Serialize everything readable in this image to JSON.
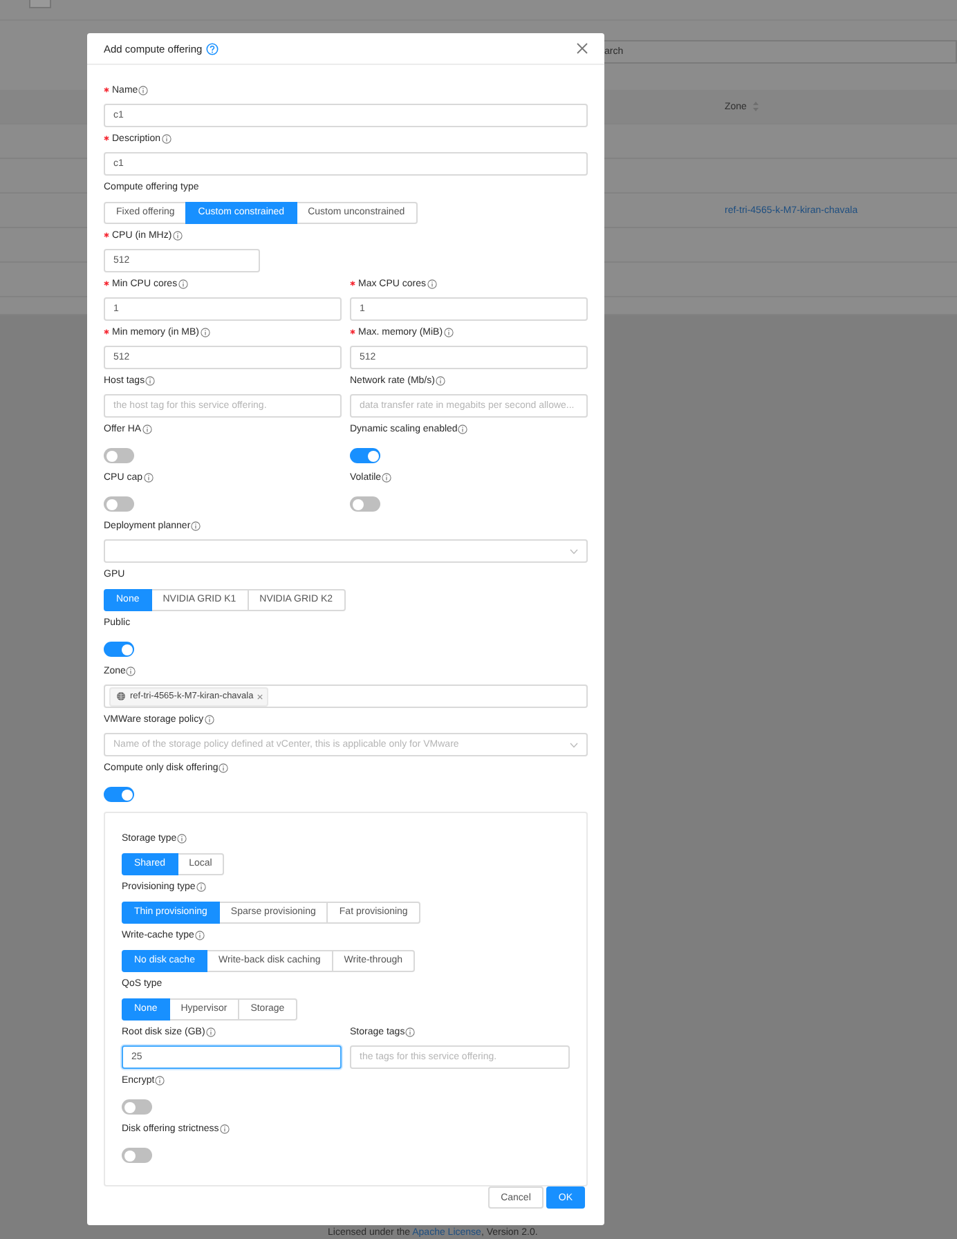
{
  "page": {
    "search": {
      "placeholder": "arch"
    },
    "table": {
      "columns": [
        "Zone"
      ],
      "rows": [
        {
          "zone": "ref-tri-4565-k-M7-kiran-chavala"
        }
      ]
    },
    "footer": {
      "before": "Licensed under the ",
      "link": "Apache License",
      "after": ", Version 2.0."
    }
  },
  "dialog": {
    "title": "Add compute offering",
    "rows": [
      {
        "fields": [
          {
            "label": "Name",
            "required": true,
            "info": true,
            "kind": "input",
            "value": "c1"
          }
        ]
      },
      {
        "fields": [
          {
            "label": "Description",
            "required": true,
            "info": true,
            "kind": "input",
            "value": "c1"
          }
        ]
      },
      {
        "fields": [
          {
            "label": "Compute offering type",
            "required": false,
            "info": false,
            "kind": "segmented",
            "options": [
              {
                "label": "Fixed offering",
                "selected": false
              },
              {
                "label": "Custom constrained",
                "selected": true
              },
              {
                "label": "Custom unconstrained",
                "selected": false
              }
            ]
          }
        ]
      },
      {
        "fields": [
          {
            "label": "CPU (in MHz)",
            "required": true,
            "info": true,
            "kind": "number",
            "value": "512"
          }
        ]
      },
      {
        "fields": [
          {
            "label": "Min CPU cores",
            "required": true,
            "info": true,
            "kind": "number",
            "value": "1"
          },
          {
            "label": "Max CPU cores",
            "required": true,
            "info": true,
            "kind": "number",
            "value": "1"
          }
        ]
      },
      {
        "fields": [
          {
            "label": "Min memory (in MB)",
            "required": true,
            "info": true,
            "kind": "number",
            "value": "512"
          },
          {
            "label": "Max. memory (MiB)",
            "required": true,
            "info": true,
            "kind": "number",
            "value": "512"
          }
        ]
      },
      {
        "fields": [
          {
            "label": "Host tags",
            "required": false,
            "info": true,
            "kind": "input",
            "placeholder": "the host tag for this service offering."
          },
          {
            "label": "Network rate (Mb/s)",
            "required": false,
            "info": true,
            "kind": "input",
            "placeholder": "data transfer rate in megabits per second allowe..."
          }
        ]
      },
      {
        "fields": [
          {
            "label": "Offer HA",
            "required": false,
            "info": true,
            "kind": "toggle",
            "on": false
          },
          {
            "label": "Dynamic scaling enabled",
            "required": false,
            "info": true,
            "kind": "toggle",
            "on": true
          }
        ]
      },
      {
        "fields": [
          {
            "label": "CPU cap",
            "required": false,
            "info": true,
            "kind": "toggle",
            "on": false
          },
          {
            "label": "Volatile",
            "required": false,
            "info": true,
            "kind": "toggle",
            "on": false
          }
        ]
      },
      {
        "fields": [
          {
            "label": "Deployment planner",
            "required": false,
            "info": true,
            "kind": "select"
          }
        ]
      },
      {
        "fields": [
          {
            "label": "GPU",
            "required": false,
            "info": false,
            "kind": "segmented",
            "options": [
              {
                "label": "None",
                "selected": true
              },
              {
                "label": "NVIDIA GRID K1",
                "selected": false
              },
              {
                "label": "NVIDIA GRID K2",
                "selected": false
              }
            ]
          }
        ]
      },
      {
        "fields": [
          {
            "label": "Public",
            "required": false,
            "info": false,
            "kind": "toggle",
            "on": true
          }
        ]
      },
      {
        "fields": [
          {
            "label": "Zone",
            "required": false,
            "info": true,
            "kind": "tags",
            "tags": [
              "ref-tri-4565-k-M7-kiran-chavala"
            ]
          }
        ]
      },
      {
        "fields": [
          {
            "label": "VMWare storage policy",
            "required": false,
            "info": true,
            "kind": "select",
            "placeholder": "Name of the storage policy defined at vCenter, this is applicable only for VMware"
          }
        ]
      },
      {
        "fields": [
          {
            "label": "Compute only disk offering",
            "required": false,
            "info": true,
            "kind": "toggle",
            "on": true
          }
        ]
      }
    ],
    "panel": {
      "rows": [
        {
          "fields": [
            {
              "label": "Storage type",
              "required": false,
              "info": true,
              "kind": "segmented",
              "options": [
                {
                  "label": "Shared",
                  "selected": true
                },
                {
                  "label": "Local",
                  "selected": false
                }
              ]
            }
          ]
        },
        {
          "fields": [
            {
              "label": "Provisioning type",
              "required": false,
              "info": true,
              "kind": "segmented",
              "options": [
                {
                  "label": "Thin provisioning",
                  "selected": true
                },
                {
                  "label": "Sparse provisioning",
                  "selected": false
                },
                {
                  "label": "Fat provisioning",
                  "selected": false
                }
              ]
            }
          ]
        },
        {
          "fields": [
            {
              "label": "Write-cache type",
              "required": false,
              "info": true,
              "kind": "segmented",
              "options": [
                {
                  "label": "No disk cache",
                  "selected": true
                },
                {
                  "label": "Write-back disk caching",
                  "selected": false
                },
                {
                  "label": "Write-through",
                  "selected": false
                }
              ]
            }
          ]
        },
        {
          "fields": [
            {
              "label": "QoS type",
              "required": false,
              "info": false,
              "kind": "segmented",
              "options": [
                {
                  "label": "None",
                  "selected": true
                },
                {
                  "label": "Hypervisor",
                  "selected": false
                },
                {
                  "label": "Storage",
                  "selected": false
                }
              ]
            }
          ]
        },
        {
          "fields": [
            {
              "label": "Root disk size (GB)",
              "required": false,
              "info": true,
              "kind": "number",
              "value": "25",
              "focused": true
            },
            {
              "label": "Storage tags",
              "required": false,
              "info": true,
              "kind": "input",
              "placeholder": "the tags for this service offering.",
              "focused": false
            }
          ]
        },
        {
          "fields": [
            {
              "label": "Encrypt",
              "required": false,
              "info": true,
              "kind": "toggle",
              "on": false
            }
          ]
        },
        {
          "fields": [
            {
              "label": "Disk offering strictness",
              "required": false,
              "info": true,
              "kind": "toggle",
              "on": false
            }
          ]
        }
      ]
    },
    "buttons": [
      {
        "label": "Cancel",
        "primary": false
      },
      {
        "label": "OK",
        "primary": true
      }
    ]
  }
}
